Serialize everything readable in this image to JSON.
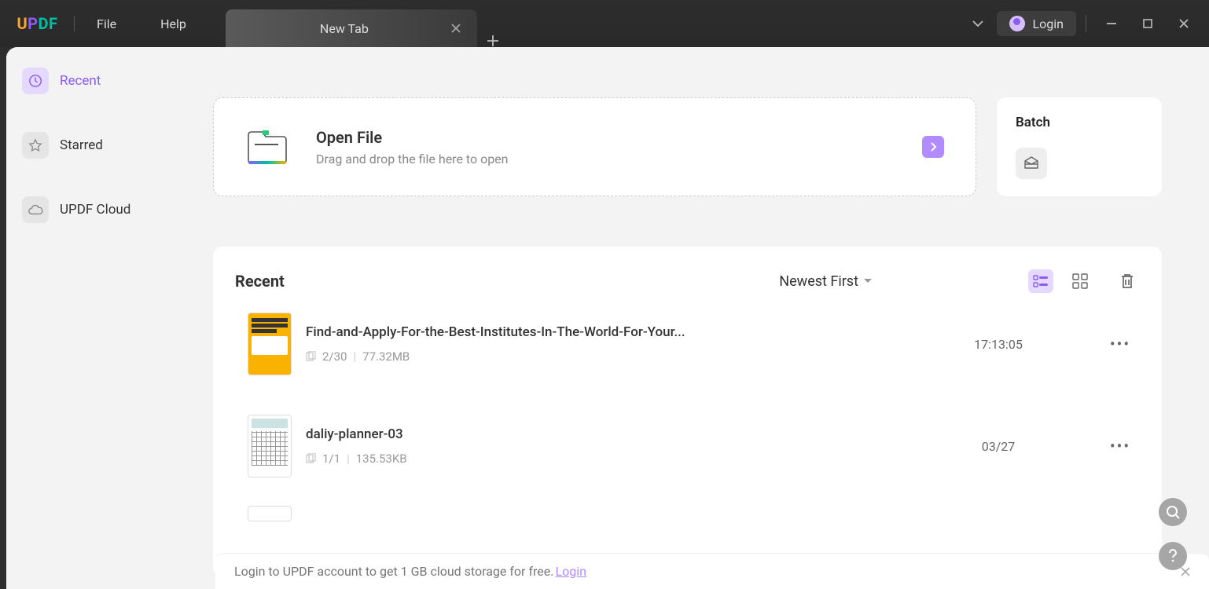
{
  "menu": {
    "file": "File",
    "help": "Help"
  },
  "tab": {
    "title": "New Tab"
  },
  "login_label": "Login",
  "sidebar": {
    "recent": "Recent",
    "starred": "Starred",
    "cloud": "UPDF Cloud"
  },
  "open": {
    "title": "Open File",
    "subtitle": "Drag and drop the file here to open"
  },
  "batch": {
    "title": "Batch"
  },
  "files": {
    "heading": "Recent",
    "sort": "Newest First",
    "items": [
      {
        "name": "Find-and-Apply-For-the-Best-Institutes-In-The-World-For-Your...",
        "pages": "2/30",
        "size": "77.32MB",
        "time": "17:13:05"
      },
      {
        "name": "daliy-planner-03",
        "pages": "1/1",
        "size": "135.53KB",
        "time": "03/27"
      }
    ]
  },
  "banner": {
    "text": "Login to UPDF account to get 1 GB cloud storage for free.",
    "link": "Login"
  }
}
